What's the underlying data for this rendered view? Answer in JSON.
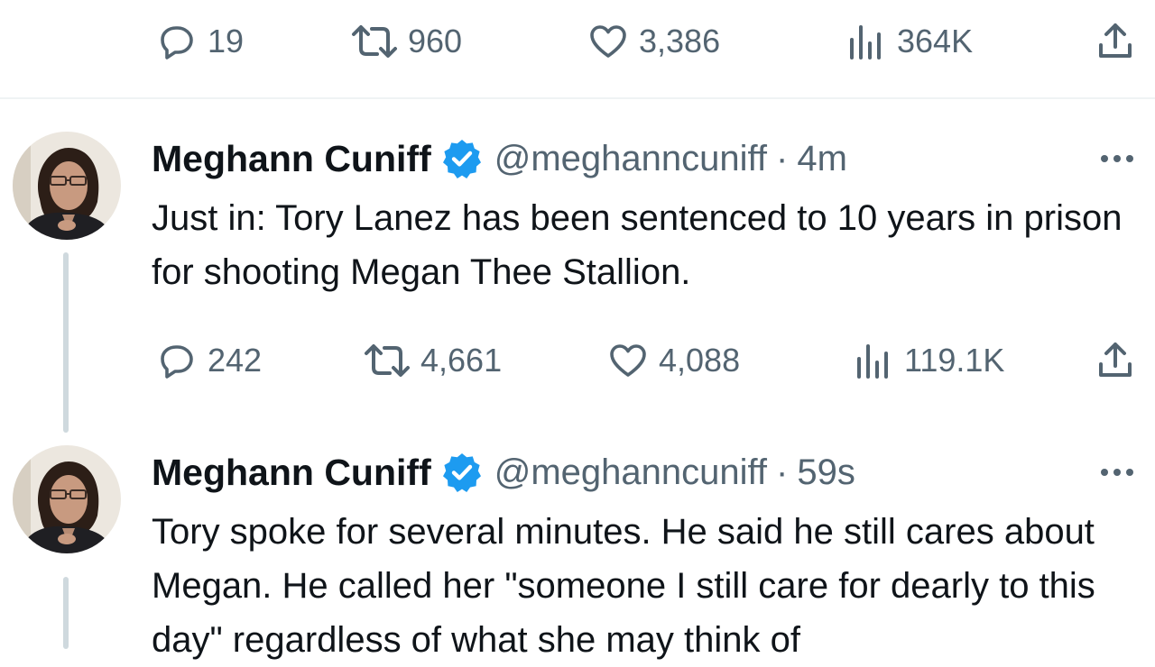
{
  "top_actions": {
    "replies": "19",
    "retweets": "960",
    "likes": "3,386",
    "views": "364K"
  },
  "tweets": [
    {
      "name": "Meghann Cuniff",
      "handle": "@meghanncuniff",
      "separator": "·",
      "time": "4m",
      "text": "Just in: Tory Lanez has been sentenced to 10 years in prison for shooting Megan Thee Stallion.",
      "replies": "242",
      "retweets": "4,661",
      "likes": "4,088",
      "views": "119.1K"
    },
    {
      "name": "Meghann Cuniff",
      "handle": "@meghanncuniff",
      "separator": "·",
      "time": "59s",
      "text": "Tory spoke for several minutes. He said he still cares about Megan. He called her \"someone I still care for dearly to this day\" regardless of what she may think of"
    }
  ],
  "colors": {
    "verified": "#1d9bf0",
    "secondary_text": "#536471",
    "thread_line": "#cfd9de",
    "divider": "#eff3f4"
  },
  "icons": [
    "reply-icon",
    "retweet-icon",
    "like-icon",
    "views-icon",
    "share-icon",
    "verified-badge-icon",
    "more-options-icon"
  ]
}
